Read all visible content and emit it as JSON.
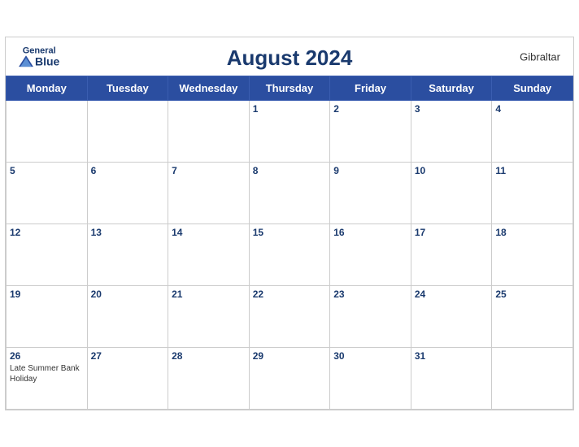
{
  "header": {
    "title": "August 2024",
    "region": "Gibraltar",
    "logo": {
      "general": "General",
      "blue": "Blue"
    }
  },
  "weekdays": [
    "Monday",
    "Tuesday",
    "Wednesday",
    "Thursday",
    "Friday",
    "Saturday",
    "Sunday"
  ],
  "weeks": [
    [
      {
        "day": "",
        "empty": true
      },
      {
        "day": "",
        "empty": true
      },
      {
        "day": "",
        "empty": true
      },
      {
        "day": "1",
        "events": []
      },
      {
        "day": "2",
        "events": []
      },
      {
        "day": "3",
        "events": []
      },
      {
        "day": "4",
        "events": []
      }
    ],
    [
      {
        "day": "5",
        "events": []
      },
      {
        "day": "6",
        "events": []
      },
      {
        "day": "7",
        "events": []
      },
      {
        "day": "8",
        "events": []
      },
      {
        "day": "9",
        "events": []
      },
      {
        "day": "10",
        "events": []
      },
      {
        "day": "11",
        "events": []
      }
    ],
    [
      {
        "day": "12",
        "events": []
      },
      {
        "day": "13",
        "events": []
      },
      {
        "day": "14",
        "events": []
      },
      {
        "day": "15",
        "events": []
      },
      {
        "day": "16",
        "events": []
      },
      {
        "day": "17",
        "events": []
      },
      {
        "day": "18",
        "events": []
      }
    ],
    [
      {
        "day": "19",
        "events": []
      },
      {
        "day": "20",
        "events": []
      },
      {
        "day": "21",
        "events": []
      },
      {
        "day": "22",
        "events": []
      },
      {
        "day": "23",
        "events": []
      },
      {
        "day": "24",
        "events": []
      },
      {
        "day": "25",
        "events": []
      }
    ],
    [
      {
        "day": "26",
        "events": [
          "Late Summer Bank Holiday"
        ]
      },
      {
        "day": "27",
        "events": []
      },
      {
        "day": "28",
        "events": []
      },
      {
        "day": "29",
        "events": []
      },
      {
        "day": "30",
        "events": []
      },
      {
        "day": "31",
        "events": []
      },
      {
        "day": "",
        "empty": true
      }
    ]
  ]
}
